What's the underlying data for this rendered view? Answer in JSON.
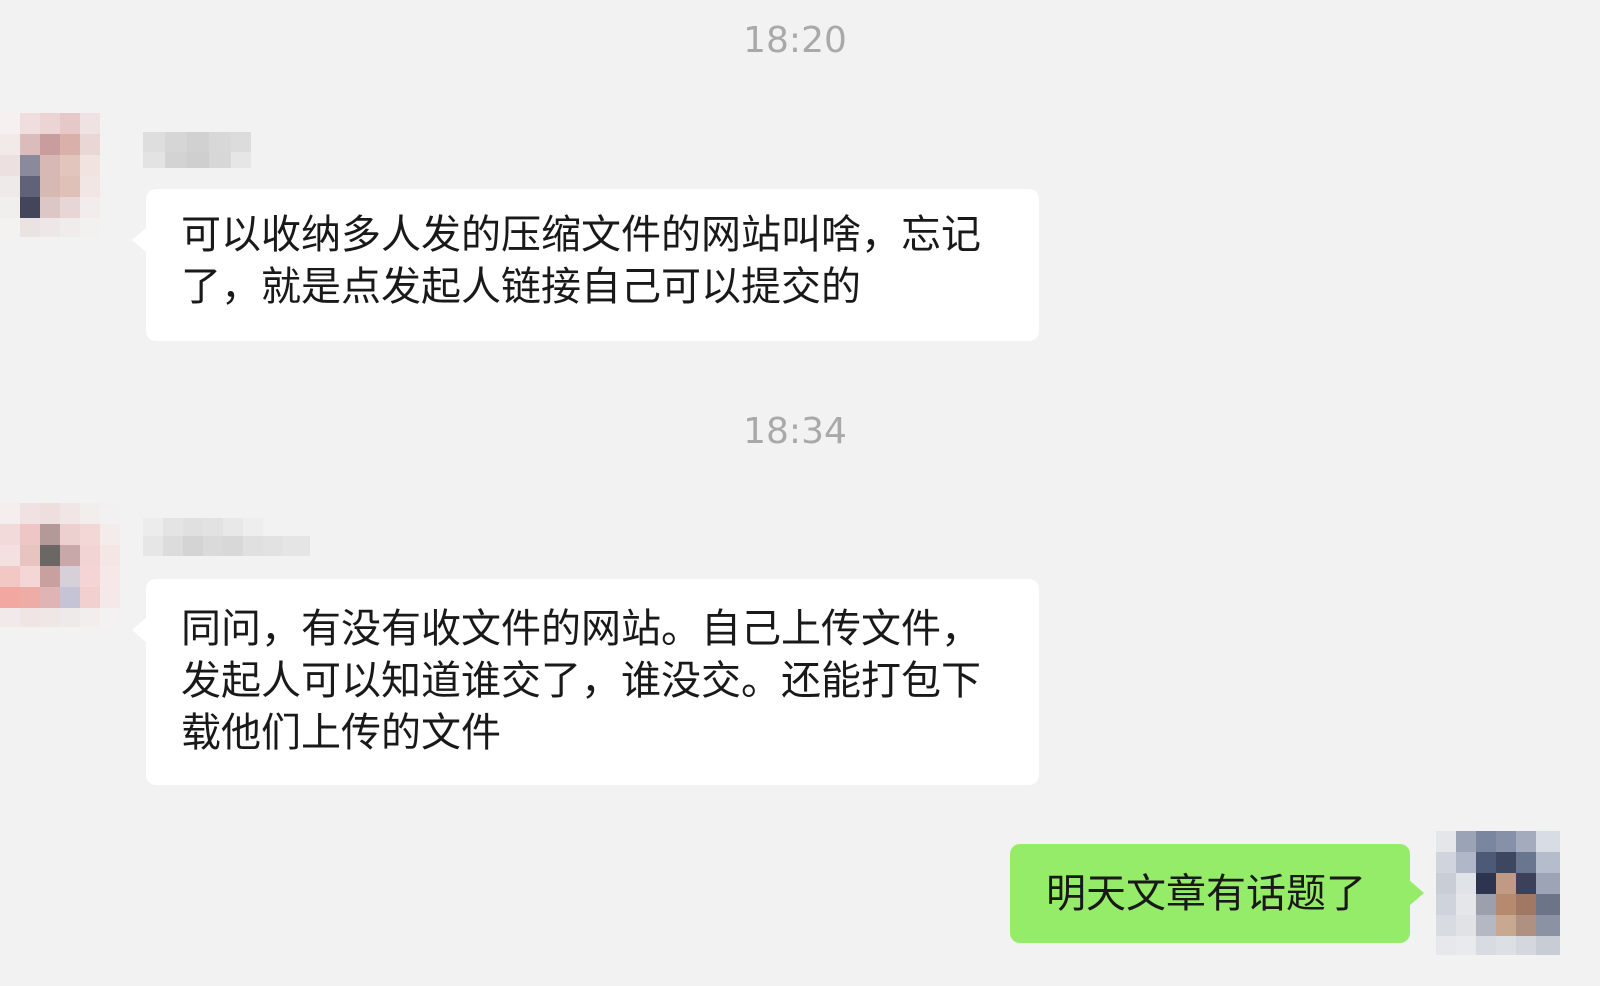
{
  "conversation": {
    "messages": [
      {
        "timestamp": "18:20",
        "sender": "other",
        "text": "可以收纳多人发的压缩文件的网站叫啥，忘记了，就是点发起人链接自己可以提交的"
      },
      {
        "timestamp": "18:34",
        "sender": "other",
        "text": "同问，有没有收文件的网站。自己上传文件，发起人可以知道谁交了，谁没交。还能打包下载他们上传的文件"
      },
      {
        "sender": "self",
        "text": "明天文章有话题了"
      }
    ]
  },
  "icons": {
    "avatar_1": "blurred-avatar",
    "avatar_2": "blurred-avatar",
    "avatar_self": "blurred-avatar"
  },
  "colors": {
    "background": "#f2f2f2",
    "incoming_bubble": "#ffffff",
    "outgoing_bubble": "#95ec69",
    "timestamp": "#a9a9a9",
    "message_text": "#191919"
  }
}
